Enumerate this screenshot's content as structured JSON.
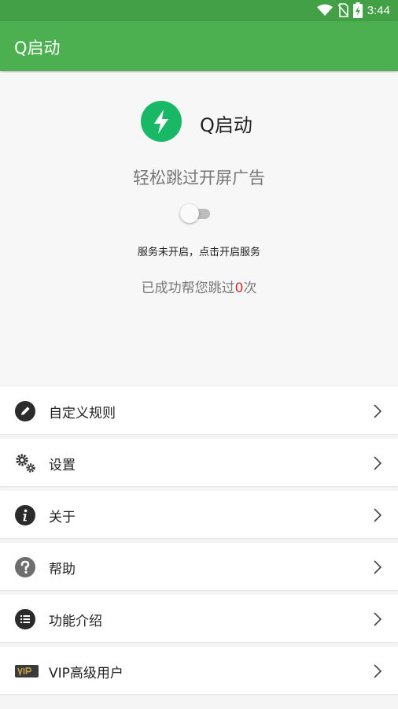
{
  "status_bar": {
    "time": "3:44",
    "icons": [
      "wifi-icon",
      "no-sim-icon",
      "battery-charging-icon"
    ]
  },
  "app_bar": {
    "title": "Q启动"
  },
  "hero": {
    "logo_icon": "lightning-bolt-icon",
    "app_name": "Q启动",
    "slogan": "轻松跳过开屏广告",
    "service_toggle_on": false,
    "service_status": "服务未开启，点击开启服务",
    "skip_prefix": "已成功帮您跳过",
    "skip_count": "0",
    "skip_suffix": "次"
  },
  "menu": {
    "items": [
      {
        "label": "自定义规则",
        "icon": "pencil-icon"
      },
      {
        "label": "设置",
        "icon": "gears-icon"
      },
      {
        "label": "关于",
        "icon": "info-icon"
      },
      {
        "label": "帮助",
        "icon": "question-icon"
      },
      {
        "label": "功能介绍",
        "icon": "list-icon"
      },
      {
        "label": "VIP高级用户",
        "icon": "vip-icon"
      }
    ]
  },
  "colors": {
    "primary": "#4caf50",
    "primary_dark": "#43a047",
    "logo_green": "#18b866",
    "count_red": "#d32f2f"
  }
}
